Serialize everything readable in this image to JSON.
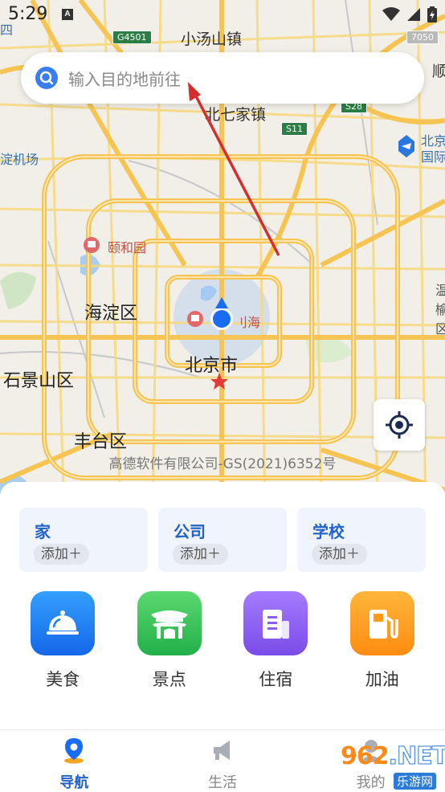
{
  "status_bar": {
    "time": "5:29",
    "notif_letter": "A"
  },
  "search": {
    "placeholder": "输入目的地前往"
  },
  "map": {
    "labels": {
      "xiaotangshan": "小汤山镇",
      "beiqijia": "北七家镇",
      "airport_left": "淀机场",
      "airport_right_1": "北京",
      "airport_right_2": "国际",
      "yiheyuan": "颐和园",
      "haidian": "海淀区",
      "shijingshan": "石景山区",
      "beijing": "北京市",
      "fengtai": "丰台区",
      "shichahai": "刂海",
      "top_left": "四",
      "right_edge_1": "顺",
      "right_edge_2": "温",
      "right_edge_3": "榆",
      "right_edge_4": "区"
    },
    "highways": {
      "g4501": "G4501",
      "s11": "S11",
      "s28": "S28",
      "s50": "7050"
    },
    "copyright": "高德软件有限公司-GS(2021)6352号"
  },
  "shortcuts": [
    {
      "title": "家",
      "add": "添加＋"
    },
    {
      "title": "公司",
      "add": "添加＋"
    },
    {
      "title": "学校",
      "add": "添加＋"
    }
  ],
  "categories": [
    {
      "label": "美食",
      "icon": "food-cloche-icon",
      "color": "#1e7ff0"
    },
    {
      "label": "景点",
      "icon": "scenic-gate-icon",
      "color": "#35c45a"
    },
    {
      "label": "住宿",
      "icon": "hotel-icon",
      "color": "#8a5cf0"
    },
    {
      "label": "加油",
      "icon": "fuel-pump-icon",
      "color": "#ff9a1a"
    }
  ],
  "tabs": [
    {
      "label": "导航",
      "icon": "location-pin-icon",
      "active": true
    },
    {
      "label": "生活",
      "icon": "megaphone-icon",
      "active": false
    },
    {
      "label": "我的",
      "icon": "profile-icon",
      "active": false
    }
  ],
  "watermark": {
    "text_a": "962",
    "text_b": ".NET",
    "sub": "乐游网"
  }
}
